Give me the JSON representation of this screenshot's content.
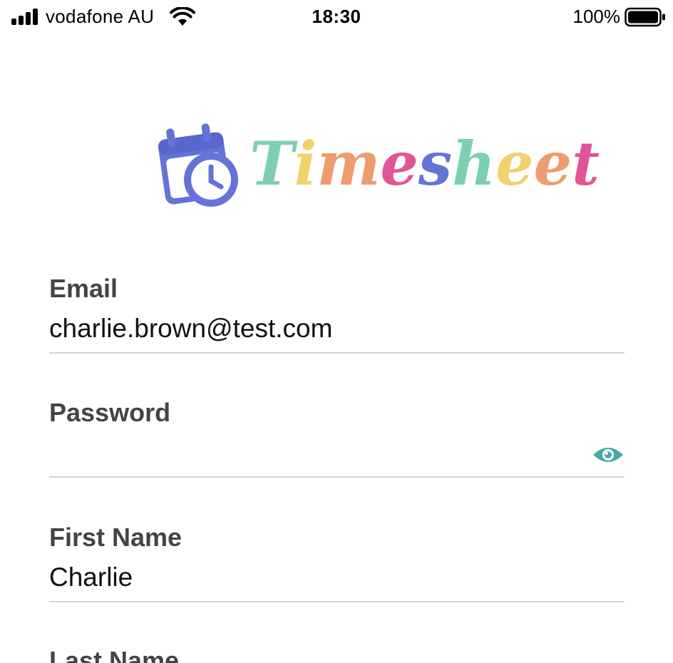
{
  "status_bar": {
    "carrier": "vodafone AU",
    "time": "18:30",
    "battery_percent": "100%",
    "signal_bars": 4,
    "icons": [
      "signal-icon",
      "wifi-icon",
      "battery-icon"
    ]
  },
  "logo": {
    "text_letters": [
      "T",
      "i",
      "m",
      "e",
      "s",
      "h",
      "e",
      "e",
      "t"
    ],
    "letter_colors": [
      "#7ccfb3",
      "#f2d16b",
      "#ee9c6e",
      "#e05595",
      "#6473d6",
      "#7ccfb3",
      "#f2d16b",
      "#ee9c6e",
      "#e05595"
    ],
    "icon": "calendar-clock-icon",
    "icon_color": "#6473d6"
  },
  "form": {
    "email": {
      "label": "Email",
      "value": "charlie.brown@test.com"
    },
    "password": {
      "label": "Password",
      "value": "",
      "toggle_icon": "eye-icon",
      "toggle_color": "#4aa8a4"
    },
    "first_name": {
      "label": "First Name",
      "value": "Charlie"
    },
    "last_name": {
      "label": "Last Name",
      "value": ""
    }
  }
}
